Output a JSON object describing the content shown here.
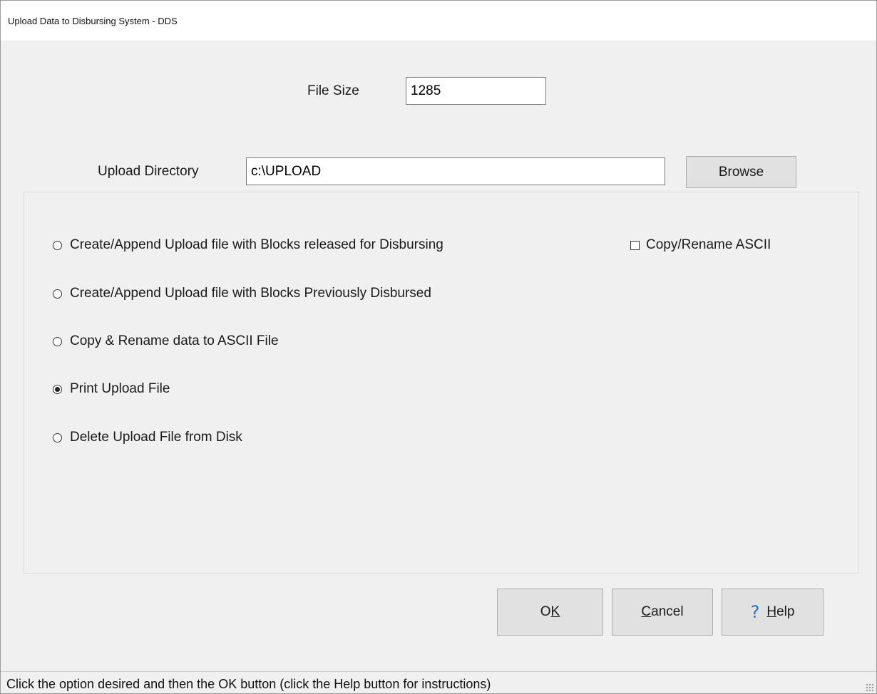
{
  "window": {
    "title": "Upload Data to Disbursing System - DDS"
  },
  "file_size": {
    "label": "File Size",
    "value": "1285"
  },
  "upload_directory": {
    "label": "Upload Directory",
    "value": "c:\\UPLOAD",
    "browse_label": "Browse"
  },
  "options": {
    "create_released": "Create/Append Upload file with Blocks released for Disbursing",
    "create_previous": "Create/Append Upload file with Blocks Previously Disbursed",
    "copy_rename": "Copy & Rename data to ASCII File",
    "print_upload": "Print Upload File",
    "delete_upload": "Delete Upload File from Disk",
    "selected": "print_upload"
  },
  "copy_rename_ascii": {
    "label": "Copy/Rename ASCII",
    "checked": false
  },
  "buttons": {
    "ok": {
      "label": "OK",
      "accelerator": "K"
    },
    "cancel": {
      "label": "Cancel",
      "accelerator": "C"
    },
    "help": {
      "label": "Help",
      "accelerator": "H",
      "icon": "question-mark-icon"
    }
  },
  "status_bar": {
    "text": "Click the option desired and then the OK button (click the Help button for instructions)"
  }
}
